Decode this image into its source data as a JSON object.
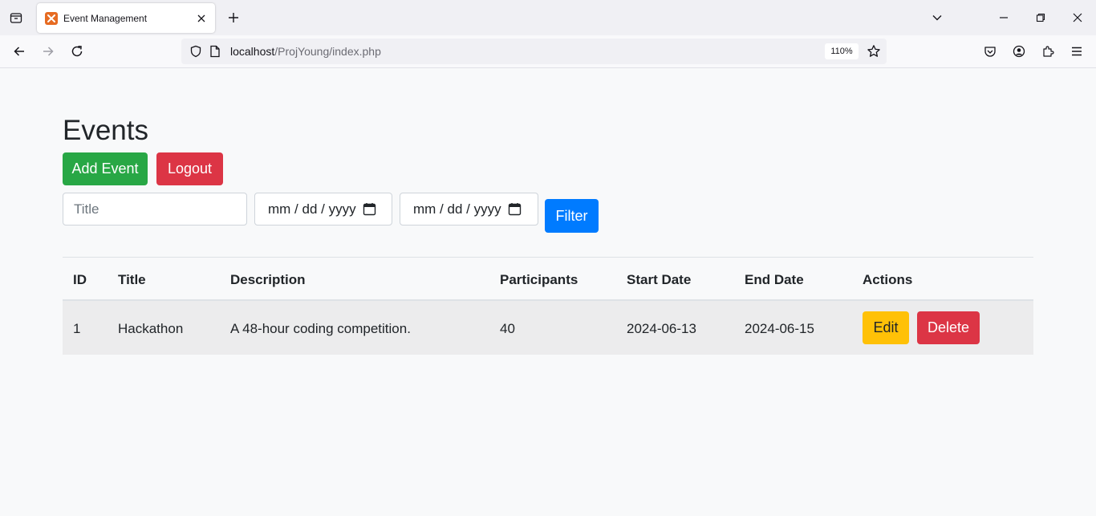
{
  "browser": {
    "tab_title": "Event Management",
    "url_host": "localhost",
    "url_path": "/ProjYoung/index.php",
    "zoom": "110%"
  },
  "page": {
    "title": "Events",
    "add_event_label": "Add Event",
    "logout_label": "Logout",
    "filter": {
      "title_placeholder": "Title",
      "start_date_placeholder": "mm / dd / yyyy",
      "end_date_placeholder": "mm / dd / yyyy",
      "filter_label": "Filter"
    }
  },
  "table": {
    "headers": [
      "ID",
      "Title",
      "Description",
      "Participants",
      "Start Date",
      "End Date",
      "Actions"
    ],
    "rows": [
      {
        "id": "1",
        "title": "Hackathon",
        "description": "A 48-hour coding competition.",
        "participants": "40",
        "start_date": "2024-06-13",
        "end_date": "2024-06-15",
        "edit_label": "Edit",
        "delete_label": "Delete"
      }
    ]
  },
  "colors": {
    "success": "#28a745",
    "danger": "#dc3545",
    "primary": "#007bff",
    "warning": "#ffc107"
  }
}
